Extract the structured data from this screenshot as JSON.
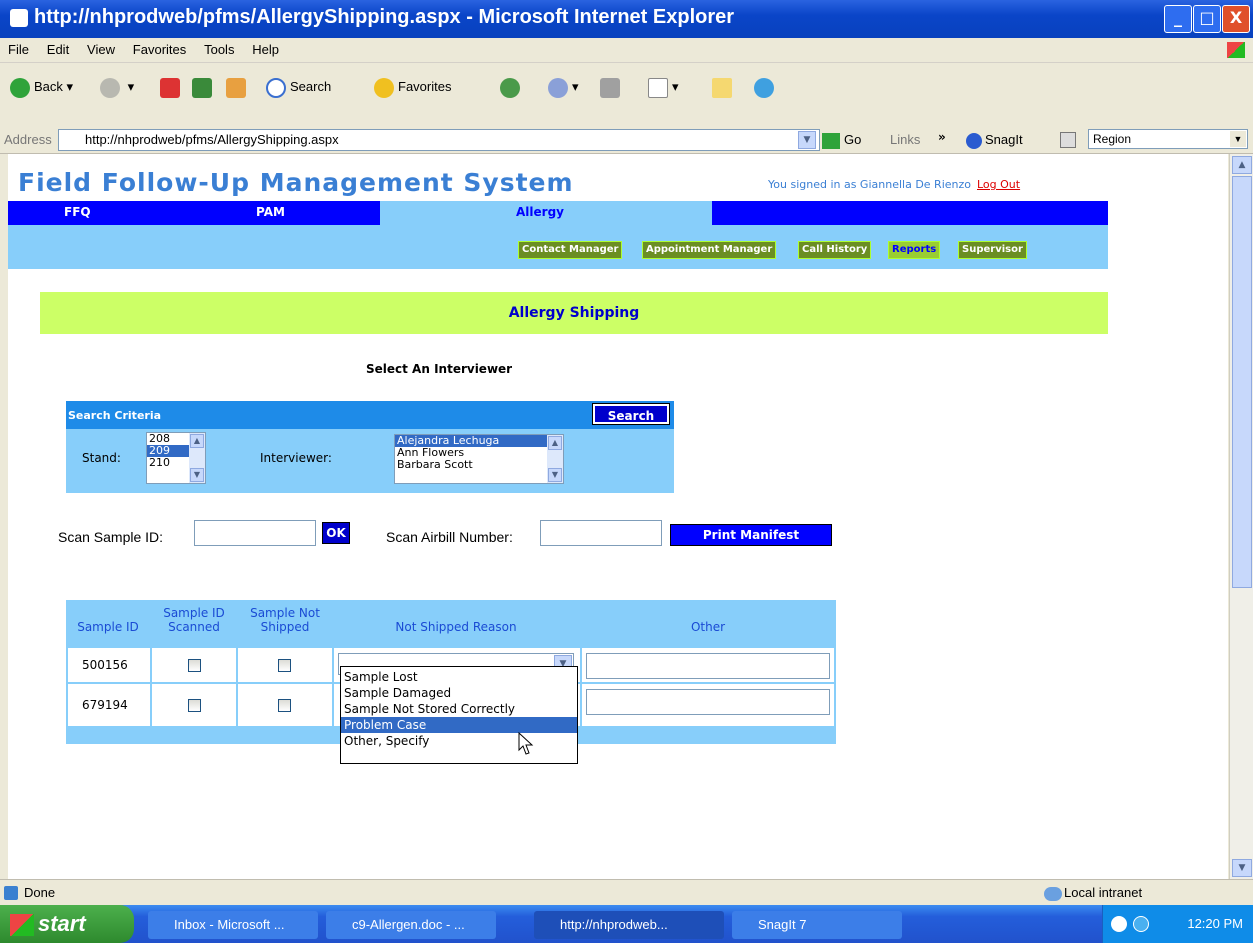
{
  "window": {
    "title": "http://nhprodweb/pfms/AllergyShipping.aspx - Microsoft Internet Explorer",
    "min": "_",
    "max": "□",
    "close": "X"
  },
  "menu": [
    "File",
    "Edit",
    "View",
    "Favorites",
    "Tools",
    "Help"
  ],
  "toolbar": {
    "back": "Back",
    "search": "Search",
    "favorites": "Favorites"
  },
  "address": {
    "label": "Address",
    "url": "http://nhprodweb/pfms/AllergyShipping.aspx",
    "go": "Go",
    "links": "Links",
    "snagit": "SnagIt",
    "region": "Region"
  },
  "app": {
    "title": "Field Follow-Up Management System",
    "signed_in": "You signed in as Giannella De Rienzo",
    "logout": "Log Out"
  },
  "nav": {
    "tabs": [
      "FFQ",
      "PAM",
      "Allergy"
    ],
    "active": "Allergy"
  },
  "subnav": [
    "Contact Manager",
    "Appointment Manager",
    "Call History",
    "Reports",
    "Supervisor"
  ],
  "page": {
    "banner": "Allergy Shipping",
    "select_interviewer": "Select An Interviewer"
  },
  "search": {
    "header": "Search Criteria",
    "button": "Search",
    "stand_label": "Stand:",
    "stands": [
      "208",
      "209",
      "210"
    ],
    "stand_selected": "209",
    "interviewer_label": "Interviewer:",
    "interviewers": [
      "Alejandra Lechuga",
      "Ann Flowers",
      "Barbara Scott"
    ],
    "interviewer_selected": "Alejandra Lechuga"
  },
  "scan": {
    "sample_label": "Scan Sample ID:",
    "ok": "OK",
    "airbill_label": "Scan Airbill Number:",
    "print": "Print Manifest"
  },
  "table": {
    "headers": {
      "sample_id": "Sample ID",
      "scanned": "Sample ID Scanned",
      "not_shipped": "Sample Not Shipped",
      "reason": "Not Shipped Reason",
      "other": "Other"
    },
    "rows": [
      {
        "id": "500156"
      },
      {
        "id": "679194"
      }
    ]
  },
  "dropdown": {
    "options": [
      "Sample Lost",
      "Sample Damaged",
      "Sample Not Stored Correctly",
      "Problem Case",
      "Other, Specify"
    ],
    "highlighted": "Problem Case"
  },
  "status": {
    "text": "Done",
    "zone": "Local intranet"
  },
  "taskbar": {
    "start": "start",
    "items": [
      "Inbox - Microsoft ...",
      "c9-Allergen.doc - ...",
      "http://nhprodweb...",
      "SnagIt 7"
    ],
    "clock": "12:20 PM"
  }
}
